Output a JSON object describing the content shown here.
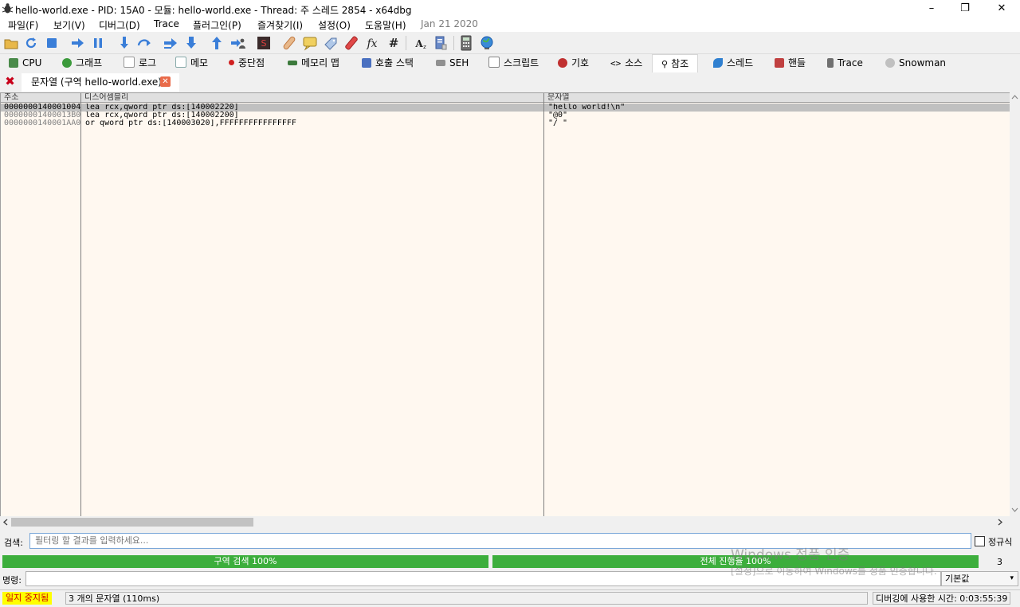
{
  "window": {
    "title": "hello-world.exe - PID: 15A0 - 모듈: hello-world.exe - Thread: 주 스레드 2854 - x64dbg",
    "minimize": "–",
    "restore": "❐",
    "close": "✕"
  },
  "menu": {
    "items": [
      "파일(F)",
      "보기(V)",
      "디버그(D)",
      "Trace",
      "플러그인(P)",
      "즐겨찾기(I)",
      "설정(O)",
      "도움말(H)"
    ],
    "date": "Jan 21 2020"
  },
  "toolbar": {
    "icons": [
      "open-icon",
      "restart-icon",
      "stop-icon",
      "run-icon",
      "pause-icon",
      "step-into-icon",
      "step-over-icon",
      "trace-into-icon",
      "trace-over-icon",
      "execute-till-return-icon",
      "run-to-user-code-icon",
      "scylla-icon",
      "patch-icon",
      "comment-icon",
      "label-icon",
      "bookmark-icon",
      "function-icon",
      "hash-icon",
      "font-icon",
      "help-icon",
      "calculator-icon",
      "globe-icon"
    ]
  },
  "tabs": [
    {
      "label": "CPU",
      "icon": "cpu-icon",
      "color": "#4a8a4a"
    },
    {
      "label": "그래프",
      "icon": "graph-icon",
      "color": "#3c9a3c"
    },
    {
      "label": "로그",
      "icon": "log-icon",
      "color": "#b0b0b0"
    },
    {
      "label": "메모",
      "icon": "notes-icon",
      "color": "#b8c8d8"
    },
    {
      "label": "중단점",
      "icon": "breakpoint-icon",
      "color": "#d02020"
    },
    {
      "label": "메모리 맵",
      "icon": "memory-map-icon",
      "color": "#3c7a3c"
    },
    {
      "label": "호출 스택",
      "icon": "call-stack-icon",
      "color": "#4a70c0"
    },
    {
      "label": "SEH",
      "icon": "seh-icon",
      "color": "#808080"
    },
    {
      "label": "스크립트",
      "icon": "script-icon",
      "color": "#a0a0a0"
    },
    {
      "label": "기호",
      "icon": "symbols-icon",
      "color": "#c03030"
    },
    {
      "label": "소스",
      "icon": "source-icon",
      "color": "#606060"
    },
    {
      "label": "참조",
      "icon": "references-icon",
      "color": "#406080"
    },
    {
      "label": "스레드",
      "icon": "threads-icon",
      "color": "#3080d0"
    },
    {
      "label": "핸들",
      "icon": "handles-icon",
      "color": "#c04040"
    },
    {
      "label": "Trace",
      "icon": "trace-icon",
      "color": "#707070"
    },
    {
      "label": "Snowman",
      "icon": "snowman-icon",
      "color": "#909090"
    }
  ],
  "subtab": {
    "label": "문자열 (구역 hello-world.exe)",
    "close": "✕"
  },
  "table": {
    "columns": [
      "주소",
      "디스어셈블리",
      "문자열"
    ],
    "rows": [
      {
        "address": "0000000140001004",
        "disasm": "lea rcx,qword ptr ds:[140002220]",
        "string": "\"hello world!\\n\""
      },
      {
        "address": "00000001400013B0",
        "disasm": "lea rcx,qword ptr ds:[140002200]",
        "string": "\"@0\""
      },
      {
        "address": "0000000140001AA0",
        "disasm": "or qword ptr ds:[140003020],FFFFFFFFFFFFFFFF",
        "string": "\"/ \""
      }
    ]
  },
  "search": {
    "label": "검색:",
    "placeholder": "필터링 할 결과를 입력하세요...",
    "regex_label": "정규식"
  },
  "progress": {
    "section": "구역 검색 100%",
    "total": "전체 진행율 100%",
    "section_value": 1.0,
    "total_value": 1.0,
    "count": "3",
    "color": "#3cae3c"
  },
  "command": {
    "label": "명령:",
    "select_value": "기본값"
  },
  "status": {
    "state": "일지 중지됨",
    "message": "3 개의 문자열 (110ms)",
    "time": "디버깅에 사용한 시간: 0:03:55:39"
  },
  "watermark": {
    "line1": "Windows 정품 인증",
    "line2": "[설정]으로 이동하여 Windows를 정품 인증합니다."
  }
}
